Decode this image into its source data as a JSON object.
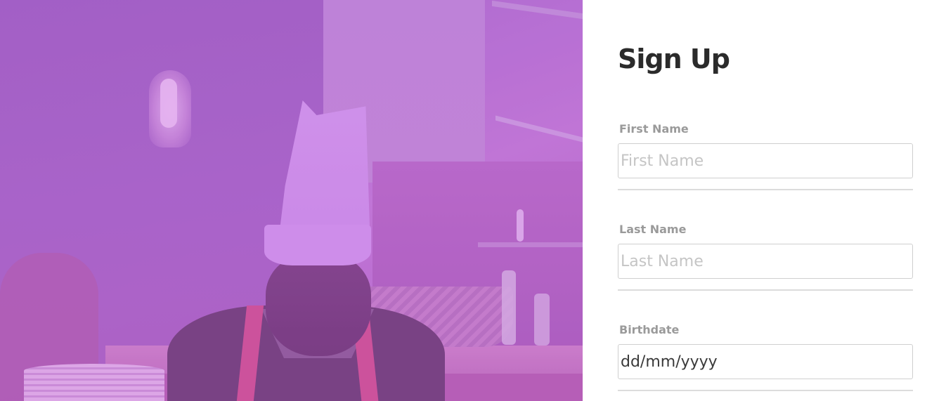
{
  "hero": {
    "image_name": "chef-photo"
  },
  "form": {
    "title": "Sign Up",
    "fields": [
      {
        "label": "First Name",
        "placeholder": "First Name",
        "value": ""
      },
      {
        "label": "Last Name",
        "placeholder": "Last Name",
        "value": ""
      },
      {
        "label": "Birthdate",
        "placeholder": "dd/mm/yyyy",
        "value": "dd/mm/yyyy"
      }
    ]
  },
  "colors": {
    "hero_tint": "#b565d0",
    "title": "#2b2b2b",
    "label": "#9a9a9a",
    "input_border": "#cfcfcf",
    "divider": "#dcdcdc"
  }
}
